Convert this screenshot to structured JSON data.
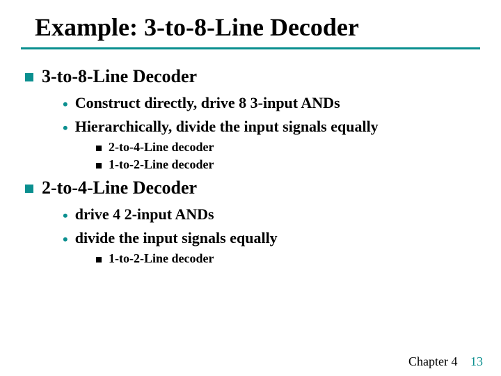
{
  "title": "Example: 3-to-8-Line Decoder",
  "section1": {
    "heading": "3-to-8-Line Decoder",
    "bullet1": "Construct directly,  drive 8 3-input ANDs",
    "bullet2": "Hierarchically, divide the input signals equally",
    "sub1": "2-to-4-Line decoder",
    "sub2": "1-to-2-Line decoder"
  },
  "section2": {
    "heading": "2-to-4-Line Decoder",
    "bullet1": "drive 4 2-input ANDs",
    "bullet2": "divide the input signals equally",
    "sub1": "1-to-2-Line decoder"
  },
  "footer": {
    "chapter": "Chapter 4",
    "page": "13"
  }
}
